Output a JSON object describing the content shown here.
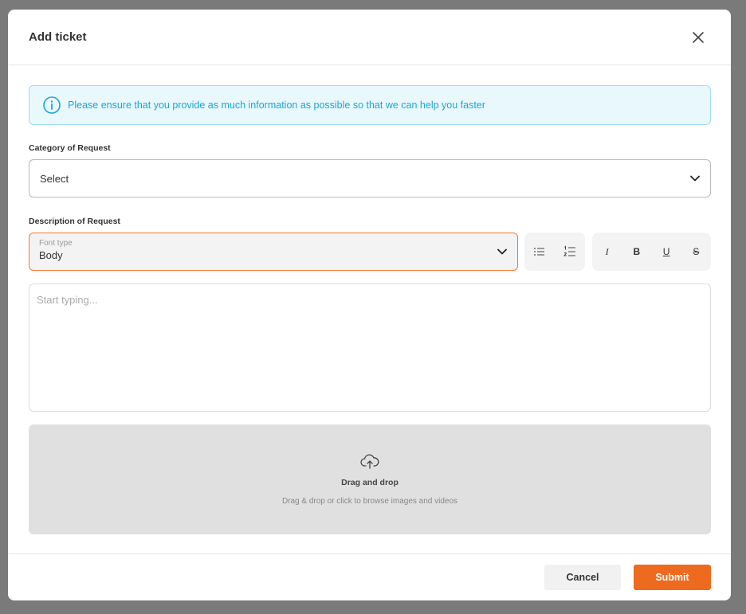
{
  "modal": {
    "title": "Add ticket",
    "close_icon": "close-icon"
  },
  "info_banner": {
    "icon": "info-icon",
    "text": "Please ensure that you provide as much information as possible so that we can help you faster",
    "color": "#1aa6d6"
  },
  "category": {
    "label": "Category of Request",
    "selected": "Select"
  },
  "description": {
    "label": "Description of Request",
    "font_type_label": "Font type",
    "font_type_value": "Body",
    "placeholder": "Start typing...",
    "toolbar": {
      "lists": [
        "bullet-list-icon",
        "numbered-list-icon"
      ],
      "format": [
        {
          "name": "italic",
          "glyph": "I"
        },
        {
          "name": "bold",
          "glyph": "B"
        },
        {
          "name": "underline",
          "glyph": "U"
        },
        {
          "name": "strikethrough",
          "glyph": "S"
        }
      ]
    }
  },
  "dropzone": {
    "icon": "cloud-upload-icon",
    "title": "Drag and drop",
    "subtitle": "Drag & drop or click to browse images and videos"
  },
  "footer": {
    "cancel_label": "Cancel",
    "submit_label": "Submit",
    "accent": "#ee6a1f"
  }
}
